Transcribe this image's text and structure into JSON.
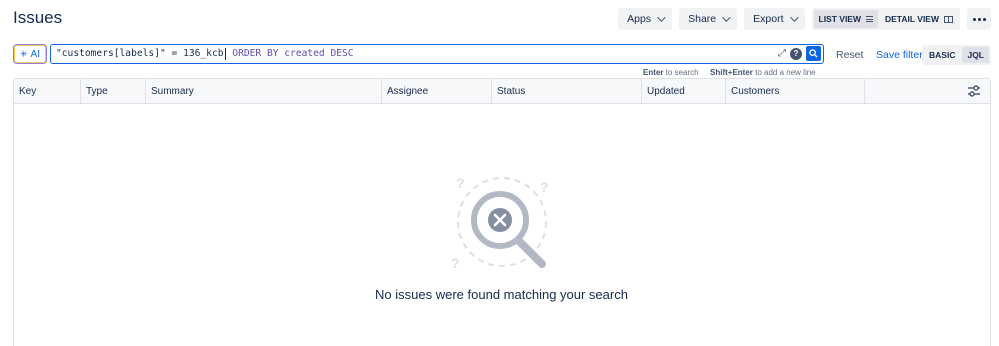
{
  "page": {
    "title": "Issues"
  },
  "top_actions": {
    "apps_label": "Apps",
    "share_label": "Share",
    "export_label": "Export",
    "list_view_label": "LIST VIEW",
    "detail_view_label": "DETAIL VIEW"
  },
  "search": {
    "ai_label": "AI",
    "jql_string_part": "\"customers[labels]\" = 136_kcb",
    "jql_keyword_part": " ORDER BY created DESC",
    "reset_label": "Reset",
    "save_filter_label": "Save filter",
    "basic_label": "BASIC",
    "jql_label": "JQL",
    "hint_enter_key": "Enter",
    "hint_enter_text": " to search",
    "hint_shift_key": "Shift+Enter",
    "hint_shift_text": " to add a new line"
  },
  "table": {
    "columns": [
      "Key",
      "Type",
      "Summary",
      "Assignee",
      "Status",
      "Updated",
      "Customers"
    ],
    "rows": []
  },
  "empty_state": {
    "message": "No issues were found matching your search"
  },
  "colors": {
    "accent": "#0c66e4",
    "text": "#172b4d",
    "jql_keyword": "#5e4db2"
  }
}
